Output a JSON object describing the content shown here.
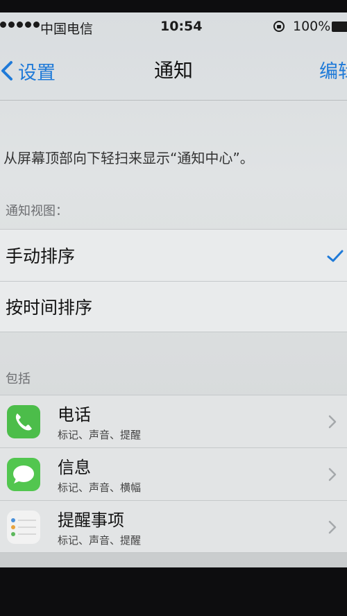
{
  "status_bar": {
    "carrier": "中国电信",
    "time": "10:54",
    "battery": "100%"
  },
  "nav": {
    "back_label": "设置",
    "title": "通知",
    "edit_label": "编辑"
  },
  "description": "从屏幕顶部向下轻扫来显示“通知中心”。",
  "notification_view": {
    "header": "通知视图：",
    "options": [
      {
        "label": "手动排序",
        "selected": true
      },
      {
        "label": "按时间排序",
        "selected": false
      }
    ]
  },
  "include": {
    "header": "包括",
    "apps": [
      {
        "name": "电话",
        "detail": "标记、声音、提醒",
        "icon": "phone-icon",
        "color": "#4cbd4a"
      },
      {
        "name": "信息",
        "detail": "标记、声音、横幅",
        "icon": "messages-icon",
        "color": "#52c64f"
      },
      {
        "name": "提醒事项",
        "detail": "标记、声音、提醒",
        "icon": "reminders-icon",
        "color": "#f2f2f2"
      }
    ]
  },
  "colors": {
    "accent": "#1f7ad8",
    "background": "#dfe2e3"
  }
}
